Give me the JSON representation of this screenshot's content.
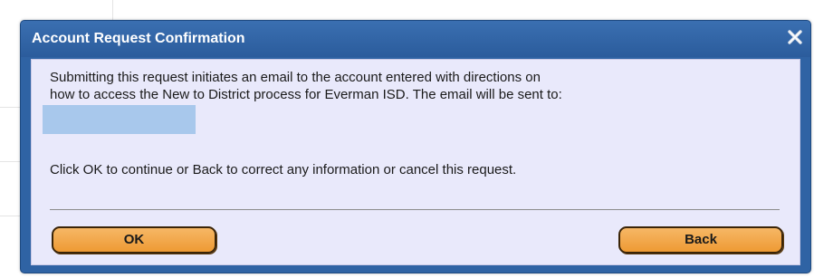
{
  "dialog": {
    "title": "Account Request Confirmation",
    "close_icon": "close-x-icon",
    "message_lines": [
      "Submitting this request initiates an email to the account entered with directions on",
      "how to access the New to District process for Everman ISD. The email will be sent to:"
    ],
    "instruction": "Click OK to continue or Back to correct any information or cancel this request.",
    "ok_label": "OK",
    "back_label": "Back"
  },
  "colors": {
    "titlebar": "#2f63a4",
    "content_background": "#e9e9fb",
    "button": "#ee9a33",
    "redaction": "#a8c8ec"
  }
}
